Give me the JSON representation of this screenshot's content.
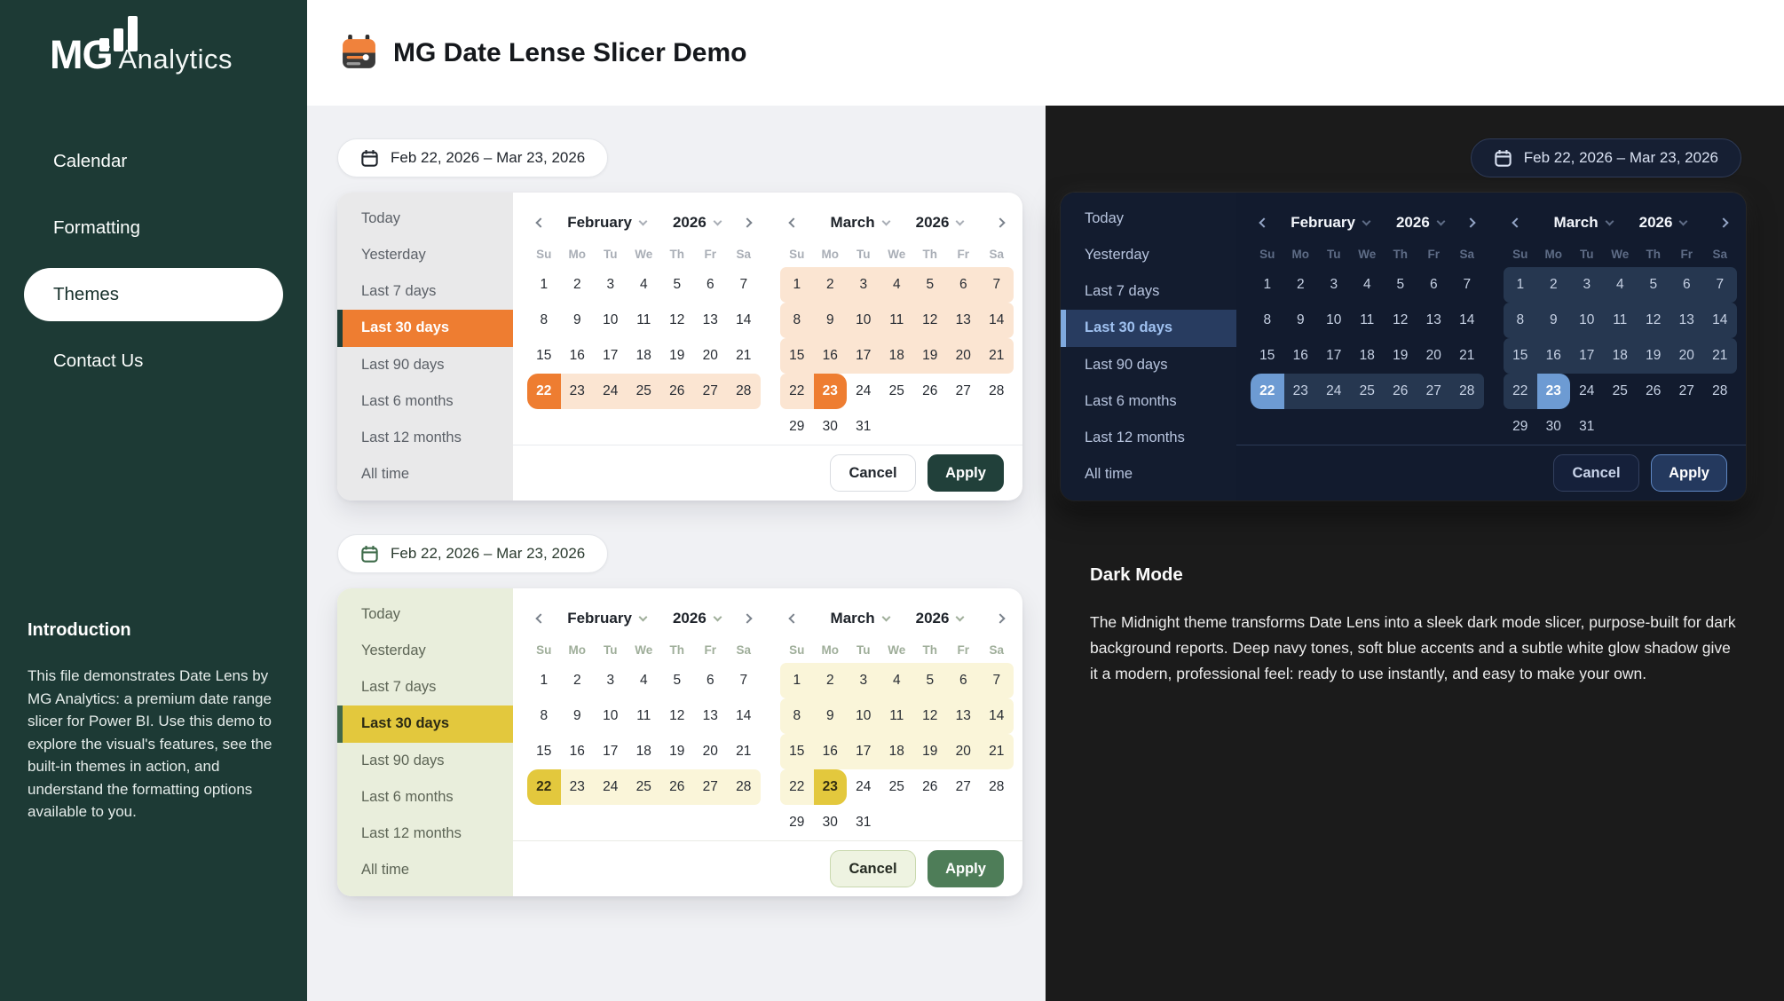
{
  "sidebar": {
    "logo_bold": "MG",
    "logo_rest": "Analytics",
    "nav": [
      {
        "label": "Calendar",
        "active": false
      },
      {
        "label": "Formatting",
        "active": false
      },
      {
        "label": "Themes",
        "active": true
      },
      {
        "label": "Contact Us",
        "active": false
      }
    ],
    "intro_title": "Introduction",
    "intro_body": "This file demonstrates Date Lens by MG Analytics: a premium date range slicer for Power BI. Use this demo to explore the visual's features, see the built-in themes in action, and understand the formatting options available to you.",
    "bg_color": "#1D3A35"
  },
  "header": {
    "title": "MG Date Lense Slicer Demo",
    "icon": "calendar-sliders-icon"
  },
  "icons": {
    "range_button": "calendar-icon",
    "prev": "chevron-left-icon",
    "next": "chevron-right-icon",
    "dropdown": "chevron-down-icon"
  },
  "dark_section": {
    "title": "Dark Mode",
    "body": "The Midnight theme transforms Date Lens into a sleek dark mode slicer, purpose-built for dark background reports. Deep navy tones, soft blue accents and a subtle white glow shadow give it a modern, professional feel: ready to use instantly, and easy to make your own.",
    "bg_color": "#1B1B1B"
  },
  "slicers": [
    {
      "range_label": "Feb 22, 2026 – Mar 23, 2026",
      "presets": [
        "Today",
        "Yesterday",
        "Last 7 days",
        "Last 30 days",
        "Last 90 days",
        "Last 6 months",
        "Last 12 months",
        "All time"
      ],
      "selected_preset": "Last 30 days",
      "weekdays": [
        "Su",
        "Mo",
        "Tu",
        "We",
        "Th",
        "Fr",
        "Sa"
      ],
      "months": [
        {
          "label": "February",
          "year": "2026",
          "weeks": [
            [
              1,
              2,
              3,
              4,
              5,
              6,
              7
            ],
            [
              8,
              9,
              10,
              11,
              12,
              13,
              14
            ],
            [
              15,
              16,
              17,
              18,
              19,
              20,
              21
            ],
            [
              22,
              23,
              24,
              25,
              26,
              27,
              28
            ]
          ],
          "range_start": 22,
          "range_end": 28,
          "selected_day": 22,
          "selected_edge": "start"
        },
        {
          "label": "March",
          "year": "2026",
          "weeks": [
            [
              1,
              2,
              3,
              4,
              5,
              6,
              7
            ],
            [
              8,
              9,
              10,
              11,
              12,
              13,
              14
            ],
            [
              15,
              16,
              17,
              18,
              19,
              20,
              21
            ],
            [
              22,
              23,
              24,
              25,
              26,
              27,
              28
            ],
            [
              29,
              30,
              31
            ]
          ],
          "range_start": 1,
          "range_end": 23,
          "selected_day": 23,
          "selected_edge": "end"
        }
      ],
      "cancel_label": "Cancel",
      "apply_label": "Apply",
      "theme": {
        "accent": "#EE7D31",
        "preset_active_bg": "#EE7D31",
        "sel_text": "#FFFFFF",
        "range_bg": "#FBE5D2",
        "panel_bg": "#E9E9EA",
        "panel_text": "#5C6168",
        "active_text": "#FFFFFF",
        "bar": "#21403A",
        "widget_bg": "#FFFFFF",
        "head_text": "#1E232A",
        "weekday_text": "#A9AEB6",
        "day_text": "#272C33",
        "divider": "#E9EBEE",
        "chev": "#7A828C",
        "cancel_bg": "#FFFFFF",
        "cancel_border": "#D9DCE1",
        "cancel_text": "#21262D",
        "apply_bg": "#21403A",
        "apply_border": "#21403A",
        "apply_text": "#FFFFFF",
        "btn_bg": "#FFFFFF",
        "btn_border": "#E4E6EA",
        "btn_text": "#21262D",
        "btn_icon": "#21262D"
      }
    },
    {
      "range_label": "Feb 22, 2026 – Mar 23, 2026",
      "presets": [
        "Today",
        "Yesterday",
        "Last 7 days",
        "Last 30 days",
        "Last 90 days",
        "Last 6 months",
        "Last 12 months",
        "All time"
      ],
      "selected_preset": "Last 30 days",
      "weekdays": [
        "Su",
        "Mo",
        "Tu",
        "We",
        "Th",
        "Fr",
        "Sa"
      ],
      "months": [
        {
          "label": "February",
          "year": "2026",
          "weeks": [
            [
              1,
              2,
              3,
              4,
              5,
              6,
              7
            ],
            [
              8,
              9,
              10,
              11,
              12,
              13,
              14
            ],
            [
              15,
              16,
              17,
              18,
              19,
              20,
              21
            ],
            [
              22,
              23,
              24,
              25,
              26,
              27,
              28
            ]
          ],
          "range_start": 22,
          "range_end": 28,
          "selected_day": 22,
          "selected_edge": "start"
        },
        {
          "label": "March",
          "year": "2026",
          "weeks": [
            [
              1,
              2,
              3,
              4,
              5,
              6,
              7
            ],
            [
              8,
              9,
              10,
              11,
              12,
              13,
              14
            ],
            [
              15,
              16,
              17,
              18,
              19,
              20,
              21
            ],
            [
              22,
              23,
              24,
              25,
              26,
              27,
              28
            ],
            [
              29,
              30,
              31
            ]
          ],
          "range_start": 1,
          "range_end": 23,
          "selected_day": 23,
          "selected_edge": "end"
        }
      ],
      "cancel_label": "Cancel",
      "apply_label": "Apply",
      "theme": {
        "accent": "#E3C83D",
        "preset_active_bg": "#E3C83D",
        "sel_text": "#332E11",
        "range_bg": "#FAF5D9",
        "panel_bg": "#E9EEDC",
        "panel_text": "#5D6556",
        "active_text": "#2B2A14",
        "bar": "#41684B",
        "widget_bg": "#FFFFFF",
        "head_text": "#1E232A",
        "weekday_text": "#9FAE9A",
        "day_text": "#272C33",
        "divider": "#E9EBE4",
        "chev": "#7A828C",
        "cancel_bg": "#EEF3E1",
        "cancel_border": "#C9D8AE",
        "cancel_text": "#252B22",
        "apply_bg": "#4E7D58",
        "apply_border": "#4E7D58",
        "apply_text": "#FFFFFF",
        "btn_bg": "#FFFFFF",
        "btn_border": "#E4E6EA",
        "btn_text": "#2A3A2E",
        "btn_icon": "#3E6B4A"
      }
    },
    {
      "range_label": "Feb 22, 2026 – Mar 23, 2026",
      "presets": [
        "Today",
        "Yesterday",
        "Last 7 days",
        "Last 30 days",
        "Last 90 days",
        "Last 6 months",
        "Last 12 months",
        "All time"
      ],
      "selected_preset": "Last 30 days",
      "weekdays": [
        "Su",
        "Mo",
        "Tu",
        "We",
        "Th",
        "Fr",
        "Sa"
      ],
      "months": [
        {
          "label": "February",
          "year": "2026",
          "weeks": [
            [
              1,
              2,
              3,
              4,
              5,
              6,
              7
            ],
            [
              8,
              9,
              10,
              11,
              12,
              13,
              14
            ],
            [
              15,
              16,
              17,
              18,
              19,
              20,
              21
            ],
            [
              22,
              23,
              24,
              25,
              26,
              27,
              28
            ]
          ],
          "range_start": 22,
          "range_end": 28,
          "selected_day": 22,
          "selected_edge": "start"
        },
        {
          "label": "March",
          "year": "2026",
          "weeks": [
            [
              1,
              2,
              3,
              4,
              5,
              6,
              7
            ],
            [
              8,
              9,
              10,
              11,
              12,
              13,
              14
            ],
            [
              15,
              16,
              17,
              18,
              19,
              20,
              21
            ],
            [
              22,
              23,
              24,
              25,
              26,
              27,
              28
            ],
            [
              29,
              30,
              31
            ]
          ],
          "range_start": 1,
          "range_end": 23,
          "selected_day": 23,
          "selected_edge": "end"
        }
      ],
      "cancel_label": "Cancel",
      "apply_label": "Apply",
      "theme": {
        "accent": "#6D9BD3",
        "preset_active_bg": "#283C60",
        "sel_text": "#FFFFFF",
        "range_bg": "#263750",
        "panel_bg": "#131C2F",
        "panel_text": "#B7C4DE",
        "active_text": "#9FC1F0",
        "bar": "#7FA9DE",
        "widget_bg": "#121B2E",
        "head_text": "#F3F6FB",
        "weekday_text": "#5E6C86",
        "day_text": "#C6D1E4",
        "divider": "#2B3A56",
        "chev": "#93A5C6",
        "cancel_bg": "#15203A",
        "cancel_border": "#33405F",
        "cancel_text": "#C9D4EA",
        "apply_bg": "#24395E",
        "apply_border": "#5F87C3",
        "apply_text": "#FFFFFF",
        "btn_bg": "#161F33",
        "btn_border": "#2F3B57",
        "btn_text": "#D8E0F1",
        "btn_icon": "#D8E0F1"
      }
    }
  ]
}
